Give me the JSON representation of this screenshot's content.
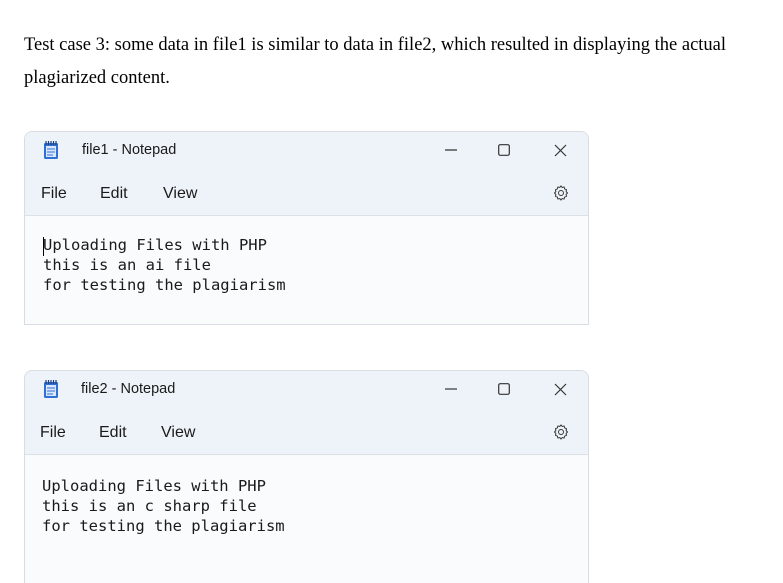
{
  "paragraph": "Test case 3: some data in file1 is similar to data in file2, which resulted in displaying the actual plagiarized content.",
  "windows": [
    {
      "title": "file1 - Notepad",
      "menu": {
        "file": "File",
        "edit": "Edit",
        "view": "View"
      },
      "lines": [
        "Uploading Files with PHP",
        "this is an ai file",
        "for testing the plagiarism"
      ]
    },
    {
      "title": "file2 - Notepad",
      "menu": {
        "file": "File",
        "edit": "Edit",
        "view": "View"
      },
      "lines": [
        "Uploading Files with PHP",
        "this is an c sharp file",
        "for testing the plagiarism"
      ]
    }
  ],
  "icons": {
    "app": "notepad-icon",
    "minimize": "minimize-icon",
    "maximize": "maximize-icon",
    "close": "close-icon",
    "settings": "gear-icon"
  },
  "colors": {
    "accent": "#2f6fd6",
    "titlebar": "#eef3f9"
  }
}
